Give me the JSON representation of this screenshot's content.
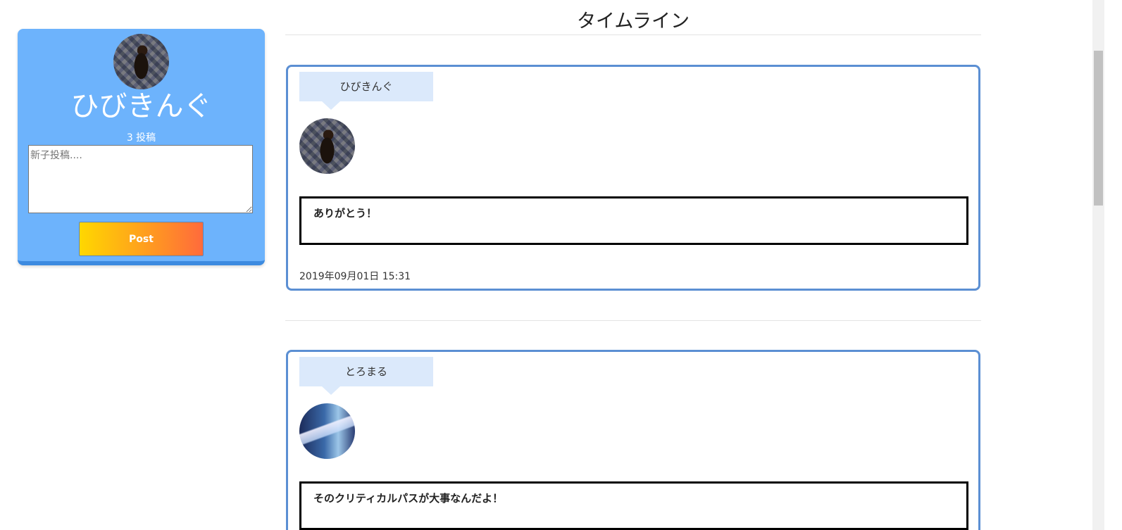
{
  "profile": {
    "name": "ひびきんぐ",
    "post_count": "3 投稿",
    "textarea_placeholder": "新子投稿....",
    "post_button_label": "Post"
  },
  "timeline": {
    "title": "タイムライン",
    "posts": [
      {
        "author": "ひびきんぐ",
        "avatar": "dog-photo-avatar",
        "message": "ありがとう！",
        "timestamp": "2019年09月01日 15:31"
      },
      {
        "author": "とろまる",
        "avatar": "anime-cover-avatar",
        "message": "そのクリティカルパスが大事なんだよ！"
      }
    ]
  },
  "colors": {
    "profile_card_bg": "#6db3fc",
    "post_border": "#5b8fd3",
    "name_balloon_bg": "#dbe9fb",
    "button_gradient_start": "#ffd700",
    "button_gradient_end": "#ff6a3c"
  }
}
